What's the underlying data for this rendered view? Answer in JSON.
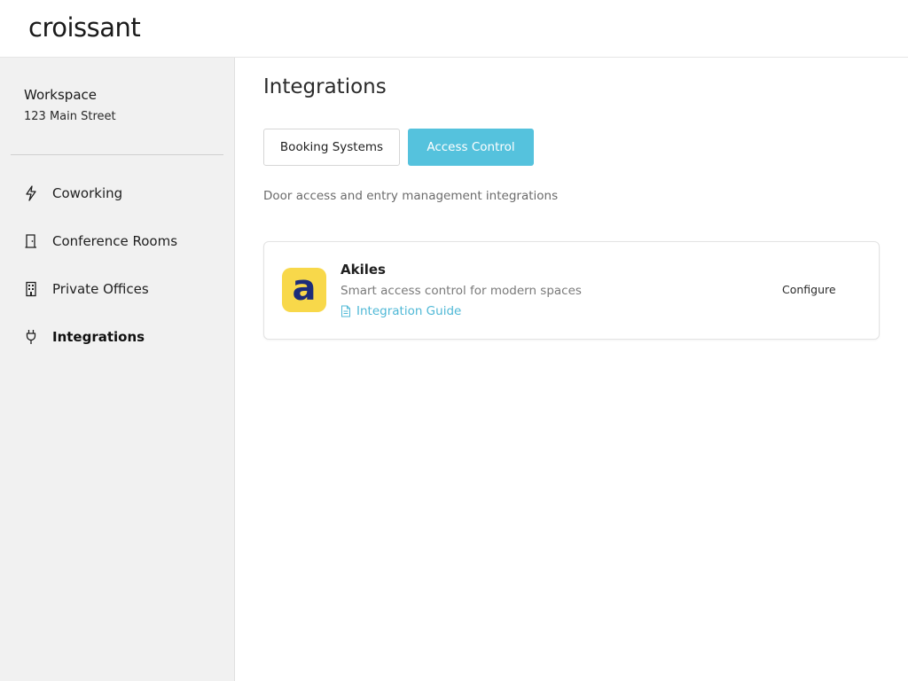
{
  "app": {
    "logo_text": "croissant"
  },
  "sidebar": {
    "workspace_name": "Workspace",
    "workspace_address": "123 Main Street",
    "items": [
      {
        "label": "Coworking",
        "icon": "lightning-icon"
      },
      {
        "label": "Conference Rooms",
        "icon": "door-icon"
      },
      {
        "label": "Private Offices",
        "icon": "building-icon"
      },
      {
        "label": "Integrations",
        "icon": "plug-icon",
        "active": true
      }
    ]
  },
  "main": {
    "title": "Integrations",
    "tabs": [
      {
        "label": "Booking Systems",
        "active": false
      },
      {
        "label": "Access Control",
        "active": true
      }
    ],
    "description": "Door access and entry management integrations",
    "integrations": [
      {
        "logo_letter": "a",
        "name": "Akiles",
        "subtitle": "Smart access control for modern spaces",
        "guide_label": "Integration Guide",
        "action_label": "Configure"
      }
    ]
  },
  "colors": {
    "accent": "#55c2dd",
    "link": "#4fb8d6",
    "sidebar_bg": "#f1f1f1",
    "akiles_logo_bg": "#f8d84a",
    "akiles_logo_fg": "#1c2c7a"
  }
}
